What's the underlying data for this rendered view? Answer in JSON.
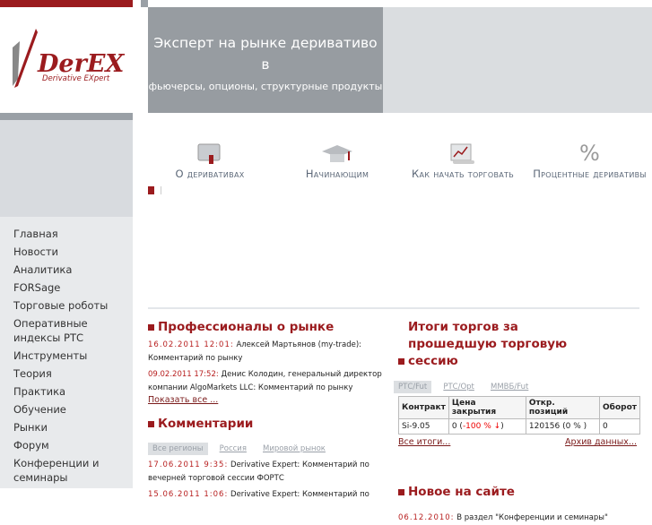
{
  "logo": {
    "name": "DerEX",
    "tagline": "Derivative EXpert"
  },
  "banner": {
    "title": "Эксперт на рынке деривативо в",
    "subtitle": "фьючерсы, опционы, структурные продукты"
  },
  "categories": [
    {
      "label": "О деривативах",
      "icon": "book-icon"
    },
    {
      "label": "Начинающим",
      "icon": "graduation-cap-icon"
    },
    {
      "label": "Как начать торговать",
      "icon": "chart-icon"
    },
    {
      "label": "Процентные деривативы",
      "icon": "percent-icon"
    }
  ],
  "nav": [
    "Главная",
    "Новости",
    "Аналитика",
    "FORSage",
    "Торговые роботы",
    "Оперативные индексы РТС",
    "Инструменты",
    "Теория",
    "Практика",
    "Обучение",
    "Рынки",
    "Форум",
    "Конференции и семинары"
  ],
  "pros": {
    "title": "Профессионалы о рынке",
    "items": [
      {
        "date": "16.02.2011 12:01:",
        "text": "Алексей Мартьянов (my-trade): Комментарий по рынку"
      },
      {
        "date": "09.02.2011 17:52:",
        "text": "Денис Колодин, генеральный директор компании AlgoMarkets LLC: Комментарий по рынку"
      }
    ],
    "show_all": "Показать все ..."
  },
  "comments": {
    "title": "Комментарии",
    "tabs": [
      "Все регионы",
      "Россия",
      "Мировой рынок"
    ],
    "items": [
      {
        "date": "17.06.2011 9:35:",
        "text": "Derivative Expert: Комментарий по вечерней торговой сессии ФОРТС"
      },
      {
        "date": "15.06.2011 1:06:",
        "text": "Derivative Expert: Комментарий по"
      }
    ]
  },
  "results": {
    "title": "Итоги торгов за прошедшую торговую сессию",
    "tabs": [
      "РТС/Fut",
      "РТС/Opt",
      "ММВБ/Fut"
    ],
    "headers": [
      "Контракт",
      "Цена закрытия",
      "Откр. позиций",
      "Оборот"
    ],
    "row": {
      "contract": "Si-9.05",
      "close": "0 (",
      "change": "-100 % ↓",
      "close_end": ")",
      "oi": "120156 (0 % )",
      "turnover": "0"
    },
    "all": "Все итоги...",
    "archive": "Архив данных..."
  },
  "news": {
    "title": "Новое на сайте",
    "items": [
      {
        "date": "06.12.2010:",
        "text": "В раздел \"Конференции и семинары\""
      }
    ]
  }
}
